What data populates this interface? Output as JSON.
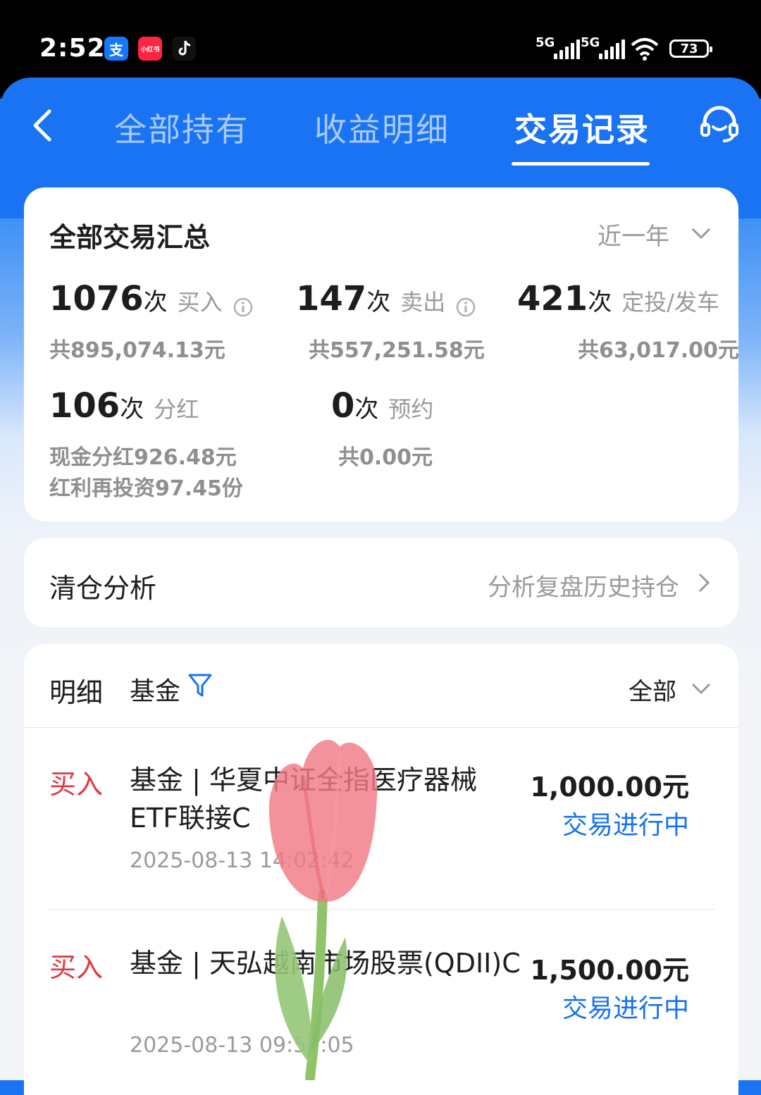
{
  "status_bar": {
    "time": "2:52",
    "app_icons": [
      "alipay-icon",
      "xiaohongshu-icon",
      "douyin-icon"
    ],
    "alipay_glyph": "支",
    "xhs_label": "小红书",
    "signal_1": "5G",
    "signal_2": "5G",
    "battery": "73"
  },
  "nav": {
    "tabs": [
      {
        "label": "全部持有"
      },
      {
        "label": "收益明细"
      },
      {
        "label": "交易记录",
        "active": true
      }
    ]
  },
  "summary": {
    "title": "全部交易汇总",
    "period": "近一年",
    "buy": {
      "count": "1076",
      "unit": "次",
      "label": "买入",
      "total": "共895,074.13元"
    },
    "sell": {
      "count": "147",
      "unit": "次",
      "label": "卖出",
      "total": "共557,251.58元"
    },
    "auto": {
      "count": "421",
      "unit": "次",
      "label": "定投/发车",
      "total": "共63,017.00元"
    },
    "dividend": {
      "count": "106",
      "unit": "次",
      "label": "分红",
      "cash": "现金分红926.48元",
      "reinvest": "红利再投资97.45份"
    },
    "reserve": {
      "count": "0",
      "unit": "次",
      "label": "预约",
      "total": "共0.00元"
    }
  },
  "clearance": {
    "title": "清仓分析",
    "link": "分析复盘历史持仓"
  },
  "details": {
    "title": "明细",
    "filter_label": "基金",
    "scope": "全部",
    "rows": [
      {
        "type": "买入",
        "name": "基金 | 华夏中证全指医疗器械ETF联接C",
        "date": "2025-08-13 14:02:42",
        "amount": "1,000.00元",
        "status": "交易进行中"
      },
      {
        "type": "买入",
        "name": "基金 | 天弘越南市场股票(QDII)C",
        "date": "2025-08-13 09:52:05",
        "amount": "1,500.00元",
        "status": "交易进行中"
      }
    ]
  },
  "colors": {
    "brand_blue": "#1a73f2",
    "buy_red": "#e0393e",
    "status_blue": "#1673f0"
  }
}
